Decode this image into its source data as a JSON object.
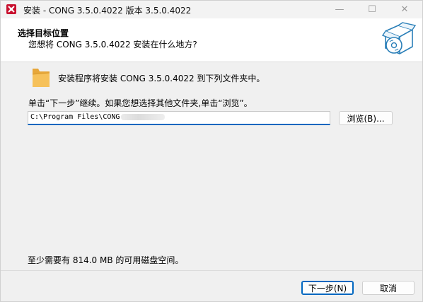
{
  "window": {
    "title": "安装 - CONG 3.5.0.4022 版本 3.5.0.4022",
    "controls": {
      "minimize": "—",
      "maximize": "☐",
      "close": "✕"
    }
  },
  "header": {
    "title": "选择目标位置",
    "subtitle": "您想将 CONG 3.5.0.4022 安装在什么地方?",
    "image_icon": "setup-box-disc-icon"
  },
  "body": {
    "folder_icon": "folder-icon",
    "info": "安装程序将安装 CONG 3.5.0.4022 到下列文件夹中。",
    "instruction": "单击“下一步”继续。如果您想选择其他文件夹,单击“浏览”。",
    "path_value": "C:\\Program Files\\CONG",
    "browse_button": "浏览(B)...",
    "disk_space": "至少需要有 814.0 MB 的可用磁盘空间。"
  },
  "footer": {
    "next_button": "下一步(N)",
    "cancel_button": "取消"
  },
  "colors": {
    "accent": "#0067c0",
    "app_icon": "#c8102e",
    "folder": "#f0b44c"
  }
}
